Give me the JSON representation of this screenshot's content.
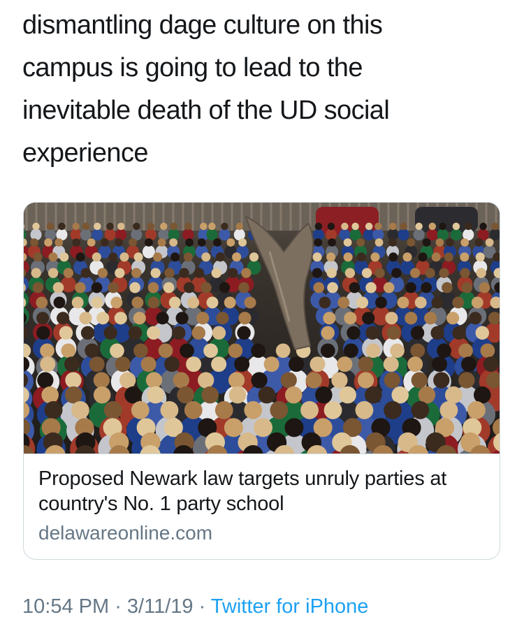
{
  "tweet": {
    "text": "dismantling dage culture on this\ncampus is going to lead to the\ninevitable death of the UD social\nexperience"
  },
  "card": {
    "title": "Proposed Newark law targets unruly parties at country's No. 1 party school",
    "domain": "delawareonline.com"
  },
  "meta": {
    "time": "10:54 PM",
    "separator": " · ",
    "date": "3/11/19",
    "source": "Twitter for iPhone"
  },
  "colors": {
    "text": "#14171a",
    "secondary": "#657786",
    "link": "#1da1f2",
    "border": "#cfd9de"
  }
}
